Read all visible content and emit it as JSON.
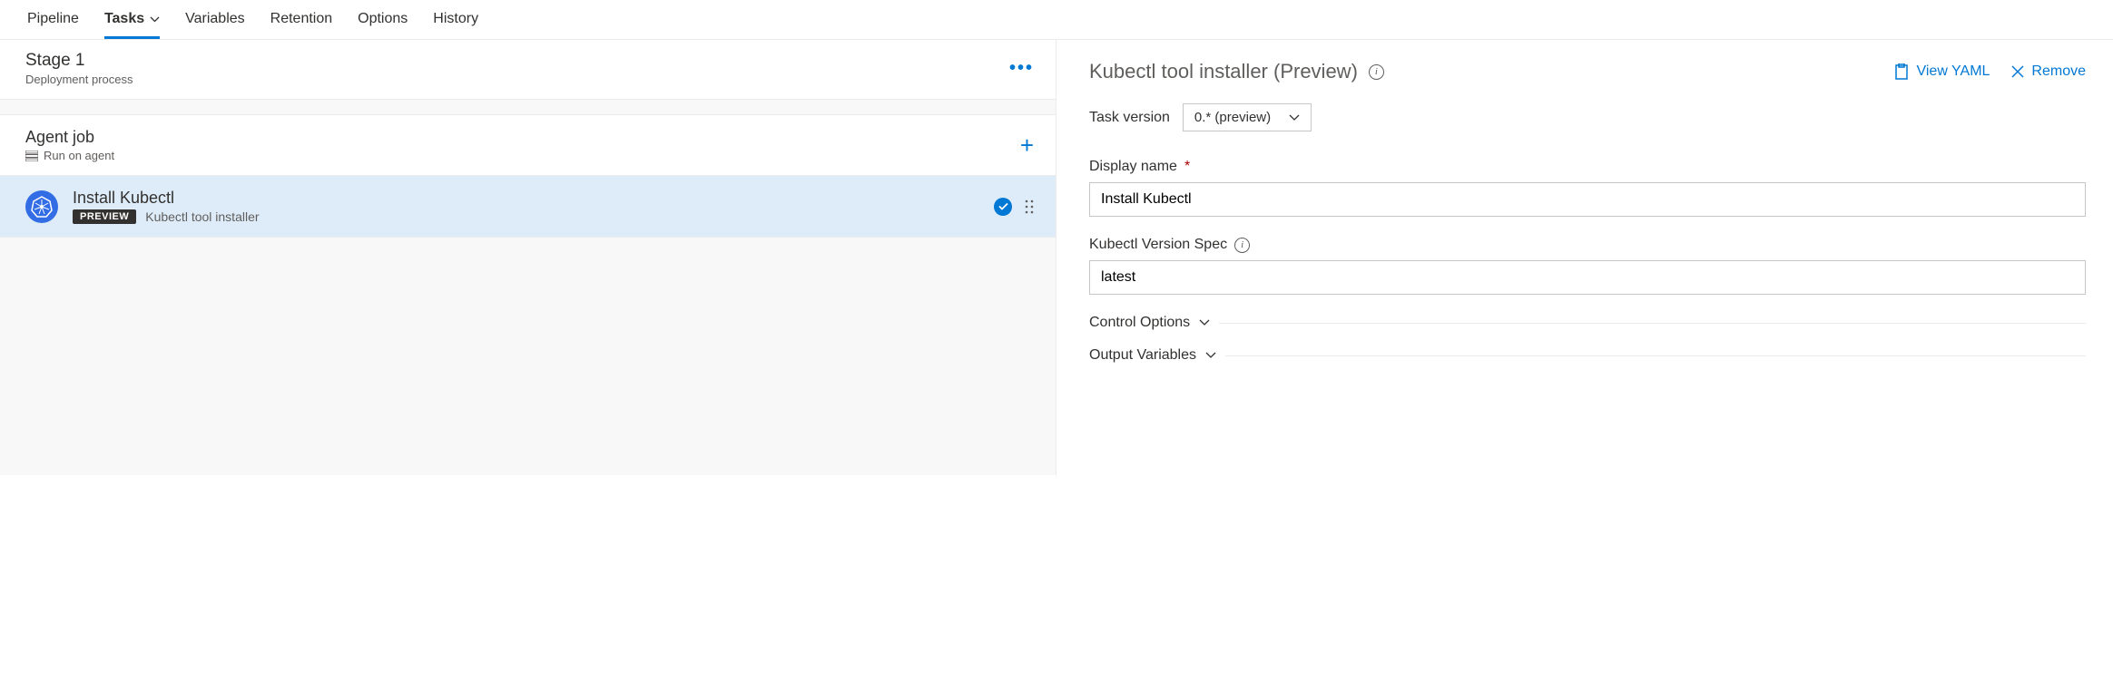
{
  "tabs": {
    "pipeline": "Pipeline",
    "tasks": "Tasks",
    "variables": "Variables",
    "retention": "Retention",
    "options": "Options",
    "history": "History"
  },
  "stage": {
    "title": "Stage 1",
    "subtitle": "Deployment process"
  },
  "agent": {
    "title": "Agent job",
    "subtitle": "Run on agent"
  },
  "task": {
    "title": "Install Kubectl",
    "badge": "PREVIEW",
    "tool": "Kubectl tool installer"
  },
  "detail": {
    "title": "Kubectl tool installer (Preview)",
    "view_yaml": "View YAML",
    "remove": "Remove",
    "task_version_label": "Task version",
    "task_version_value": "0.* (preview)",
    "display_name_label": "Display name",
    "display_name_value": "Install Kubectl",
    "version_spec_label": "Kubectl Version Spec",
    "version_spec_value": "latest",
    "control_options": "Control Options",
    "output_variables": "Output Variables"
  }
}
